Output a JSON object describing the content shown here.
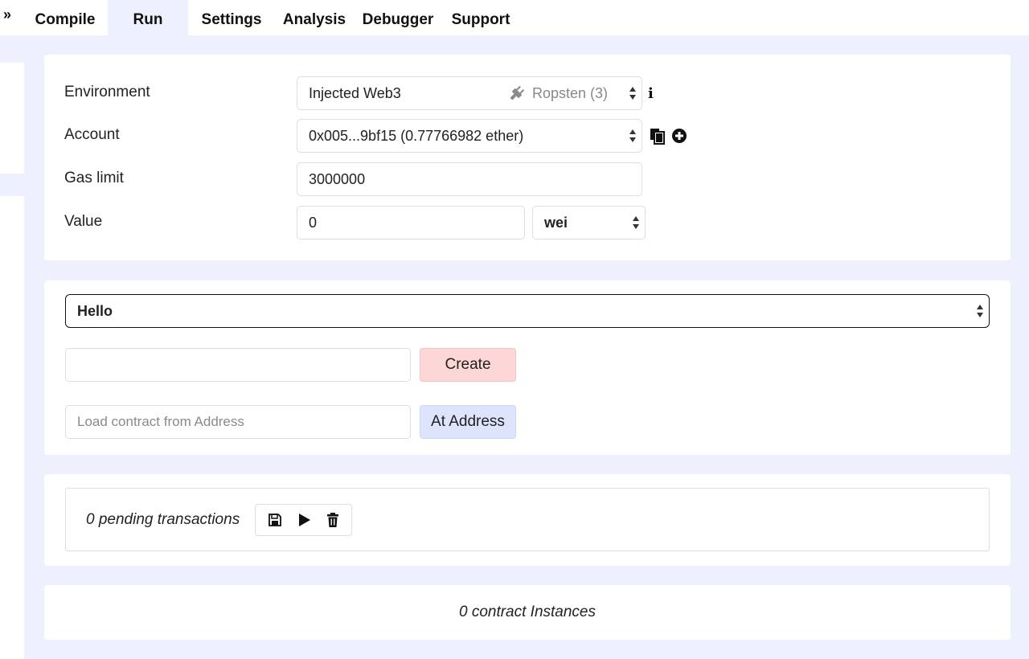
{
  "tabs": [
    {
      "label": "Compile"
    },
    {
      "label": "Run"
    },
    {
      "label": "Settings"
    },
    {
      "label": "Analysis"
    },
    {
      "label": "Debugger"
    },
    {
      "label": "Support"
    }
  ],
  "active_tab": "Run",
  "settings": {
    "environment_label": "Environment",
    "environment_value": "Injected Web3",
    "network_value": "Ropsten (3)",
    "account_label": "Account",
    "account_value": "0x005...9bf15 (0.77766982 ether)",
    "gas_limit_label": "Gas limit",
    "gas_limit_value": "3000000",
    "value_label": "Value",
    "value_value": "0",
    "value_unit": "wei"
  },
  "contract": {
    "selected": "Hello",
    "constructor_args_value": "",
    "create_label": "Create",
    "address_placeholder": "Load contract from Address",
    "at_address_label": "At Address"
  },
  "pending": {
    "text": "0 pending transactions"
  },
  "instances": {
    "text": "0 contract Instances"
  },
  "colors": {
    "panel_background": "#eef0fd",
    "create_button": "#fdd6d6",
    "at_address_button": "#dde4fb"
  },
  "icons": {
    "collapse": "chevron-double-right-icon",
    "plug": "plug-icon",
    "info": "info-icon",
    "copy": "copy-icon",
    "add": "plus-circle-icon",
    "save": "save-icon",
    "play": "play-icon",
    "trash": "trash-icon"
  }
}
